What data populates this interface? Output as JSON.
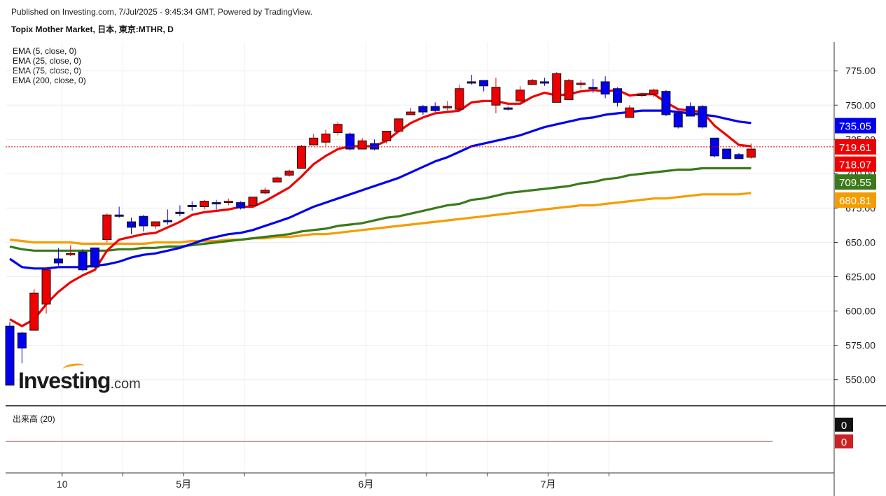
{
  "header": {
    "published": "Published on Investing.com, 7/Jul/2025 - 9:45:34 GMT, Powered by TradingView.",
    "title": "Topix Mother Market, 日本, 東京:MTHR, D"
  },
  "logo": {
    "main": "Investing",
    "suffix": ".com"
  },
  "legend": [
    {
      "label": "EMA (5, close, 0)"
    },
    {
      "label": "EMA (25, close, 0)"
    },
    {
      "label": "EMA (75, close, 0)"
    },
    {
      "label": "EMA (200, close, 0)"
    }
  ],
  "volume_panel": {
    "label": "出来高 (20)",
    "badge_values": [
      "0",
      "0"
    ]
  },
  "colors": {
    "up": "#0000ee",
    "down": "#ee0000",
    "ema5": "#ee0000",
    "ema25": "#0000ee",
    "ema75": "#3a7a1a",
    "ema200": "#f59d00",
    "grid": "#eeeeee"
  },
  "chart_data": {
    "type": "candlestick",
    "y_ticks": [
      "550.00",
      "575.00",
      "600.00",
      "625.00",
      "650.00",
      "675.00",
      "700.00",
      "725.00",
      "750.00",
      "775.00"
    ],
    "x_ticks": [
      {
        "label": "10",
        "index": 2,
        "minor": false
      },
      {
        "label": "",
        "index": 7,
        "minor": true
      },
      {
        "label": "5月",
        "index": 12,
        "minor": false
      },
      {
        "label": "",
        "index": 17,
        "minor": true
      },
      {
        "label": "6月",
        "index": 27,
        "minor": false
      },
      {
        "label": "",
        "index": 32,
        "minor": true
      },
      {
        "label": "",
        "index": 37,
        "minor": true
      },
      {
        "label": "7月",
        "index": 42,
        "minor": false
      },
      {
        "label": "",
        "index": 47,
        "minor": true
      }
    ],
    "ylim": [
      531,
      796
    ],
    "candles": [
      {
        "o": 546,
        "h": 592,
        "l": 546,
        "c": 589
      },
      {
        "o": 573,
        "h": 585,
        "l": 562,
        "c": 584
      },
      {
        "o": 613,
        "h": 616,
        "l": 586,
        "c": 586
      },
      {
        "o": 630,
        "h": 632,
        "l": 598,
        "c": 605
      },
      {
        "o": 635,
        "h": 646,
        "l": 633,
        "c": 638
      },
      {
        "o": 642,
        "h": 648,
        "l": 640,
        "c": 641
      },
      {
        "o": 630,
        "h": 645,
        "l": 629,
        "c": 643
      },
      {
        "o": 632,
        "h": 646,
        "l": 631,
        "c": 646
      },
      {
        "o": 670,
        "h": 671,
        "l": 650,
        "c": 652
      },
      {
        "o": 669,
        "h": 676,
        "l": 668,
        "c": 670
      },
      {
        "o": 661,
        "h": 668,
        "l": 656,
        "c": 665
      },
      {
        "o": 662,
        "h": 670,
        "l": 658,
        "c": 669
      },
      {
        "o": 665,
        "h": 665,
        "l": 660,
        "c": 662
      },
      {
        "o": 665,
        "h": 674,
        "l": 663,
        "c": 666
      },
      {
        "o": 671,
        "h": 677,
        "l": 669,
        "c": 672
      },
      {
        "o": 676,
        "h": 680,
        "l": 673,
        "c": 677
      },
      {
        "o": 680,
        "h": 681,
        "l": 674,
        "c": 676
      },
      {
        "o": 678,
        "h": 681,
        "l": 674,
        "c": 679
      },
      {
        "o": 680,
        "h": 682,
        "l": 677,
        "c": 679
      },
      {
        "o": 675,
        "h": 680,
        "l": 674,
        "c": 679
      },
      {
        "o": 683,
        "h": 683,
        "l": 677,
        "c": 677
      },
      {
        "o": 688,
        "h": 690,
        "l": 685,
        "c": 686
      },
      {
        "o": 697,
        "h": 698,
        "l": 694,
        "c": 694
      },
      {
        "o": 702,
        "h": 703,
        "l": 698,
        "c": 699
      },
      {
        "o": 720,
        "h": 721,
        "l": 704,
        "c": 704
      },
      {
        "o": 726,
        "h": 729,
        "l": 721,
        "c": 721
      },
      {
        "o": 729,
        "h": 732,
        "l": 720,
        "c": 723
      },
      {
        "o": 736,
        "h": 738,
        "l": 728,
        "c": 730
      },
      {
        "o": 718,
        "h": 730,
        "l": 717,
        "c": 729
      },
      {
        "o": 724,
        "h": 726,
        "l": 718,
        "c": 718
      },
      {
        "o": 718,
        "h": 725,
        "l": 717,
        "c": 722
      },
      {
        "o": 731,
        "h": 731,
        "l": 722,
        "c": 724
      },
      {
        "o": 740,
        "h": 740,
        "l": 731,
        "c": 731
      },
      {
        "o": 745,
        "h": 748,
        "l": 743,
        "c": 743
      },
      {
        "o": 745,
        "h": 750,
        "l": 743,
        "c": 749
      },
      {
        "o": 746,
        "h": 752,
        "l": 745,
        "c": 749
      },
      {
        "o": 749,
        "h": 753,
        "l": 746,
        "c": 748
      },
      {
        "o": 762,
        "h": 765,
        "l": 747,
        "c": 747
      },
      {
        "o": 767,
        "h": 772,
        "l": 765,
        "c": 767
      },
      {
        "o": 764,
        "h": 768,
        "l": 760,
        "c": 768
      },
      {
        "o": 763,
        "h": 770,
        "l": 744,
        "c": 750
      },
      {
        "o": 748,
        "h": 749,
        "l": 746,
        "c": 748
      },
      {
        "o": 761,
        "h": 764,
        "l": 752,
        "c": 753
      },
      {
        "o": 768,
        "h": 769,
        "l": 765,
        "c": 765
      },
      {
        "o": 766,
        "h": 770,
        "l": 764,
        "c": 767
      },
      {
        "o": 773,
        "h": 774,
        "l": 752,
        "c": 752
      },
      {
        "o": 768,
        "h": 769,
        "l": 754,
        "c": 754
      },
      {
        "o": 766,
        "h": 768,
        "l": 762,
        "c": 765
      },
      {
        "o": 762,
        "h": 769,
        "l": 759,
        "c": 763
      },
      {
        "o": 758,
        "h": 771,
        "l": 755,
        "c": 767
      },
      {
        "o": 752,
        "h": 763,
        "l": 749,
        "c": 762
      },
      {
        "o": 748,
        "h": 750,
        "l": 742,
        "c": 741
      },
      {
        "o": 758,
        "h": 759,
        "l": 756,
        "c": 757
      },
      {
        "o": 761,
        "h": 762,
        "l": 756,
        "c": 758
      },
      {
        "o": 743,
        "h": 761,
        "l": 742,
        "c": 760
      },
      {
        "o": 734,
        "h": 745,
        "l": 733,
        "c": 744
      },
      {
        "o": 742,
        "h": 752,
        "l": 742,
        "c": 749
      },
      {
        "o": 734,
        "h": 750,
        "l": 733,
        "c": 749
      },
      {
        "o": 713,
        "h": 726,
        "l": 712,
        "c": 726
      },
      {
        "o": 711,
        "h": 717,
        "l": 711,
        "c": 718
      },
      {
        "o": 711,
        "h": 715,
        "l": 711,
        "c": 714
      },
      {
        "o": 718,
        "h": 722,
        "l": 711,
        "c": 712
      }
    ],
    "candle_slots": [
      0,
      1,
      2,
      3,
      4,
      5,
      6,
      7,
      8,
      9,
      10,
      11,
      12,
      13,
      14,
      15,
      16,
      17,
      18,
      19,
      20,
      21,
      22,
      23,
      24,
      25,
      26,
      27,
      28,
      29,
      30,
      31,
      32,
      33,
      34,
      35,
      36,
      37,
      38,
      39,
      40,
      41,
      42,
      43,
      44,
      45,
      46,
      47,
      48,
      49,
      50,
      51,
      52,
      53,
      54,
      55,
      56,
      57,
      58,
      59,
      60,
      61
    ],
    "series": [
      {
        "name": "EMA (5, close, 0)",
        "color": "#ee0000",
        "last": "719.61",
        "values": [
          594,
          589,
          594,
          605,
          614,
          621,
          626,
          630,
          644,
          652,
          654,
          656,
          657,
          661,
          665,
          670,
          672,
          673,
          674,
          676,
          676,
          680,
          685,
          690,
          698,
          707,
          713,
          718,
          720,
          720,
          720,
          724,
          731,
          737,
          741,
          744,
          745,
          746,
          752,
          753,
          753,
          751,
          751,
          756,
          759,
          757,
          758,
          760,
          761,
          760,
          761,
          757,
          758,
          758,
          752,
          747,
          746,
          745,
          735,
          728,
          721,
          720
        ]
      },
      {
        "name": "EMA (25, close, 0)",
        "color": "#0000ee",
        "last": "735.05",
        "values": [
          638,
          632,
          631,
          631,
          632,
          632,
          632,
          633,
          634,
          636,
          639,
          641,
          642,
          644,
          646,
          649,
          652,
          654,
          656,
          657,
          659,
          662,
          665,
          668,
          672,
          676,
          679,
          682,
          685,
          688,
          691,
          694,
          697,
          701,
          705,
          709,
          712,
          716,
          720,
          722,
          724,
          726,
          728,
          731,
          734,
          736,
          738,
          740,
          741,
          743,
          744,
          745,
          746,
          746,
          746,
          745,
          744,
          743,
          742,
          740,
          738,
          737
        ]
      },
      {
        "name": "EMA (75, close, 0)",
        "color": "#3a7a1a",
        "last": "709.55",
        "values": [
          647,
          645,
          644,
          644,
          644,
          644,
          644,
          644,
          644,
          645,
          645,
          646,
          646,
          647,
          647,
          648,
          649,
          650,
          651,
          652,
          653,
          654,
          655,
          656,
          658,
          659,
          660,
          662,
          663,
          664,
          666,
          668,
          669,
          671,
          673,
          675,
          677,
          678,
          681,
          682,
          684,
          686,
          687,
          688,
          689,
          690,
          691,
          693,
          694,
          696,
          697,
          699,
          700,
          701,
          702,
          703,
          703,
          704,
          704,
          704,
          704,
          704
        ]
      },
      {
        "name": "EMA (200, close, 0)",
        "color": "#f59d00",
        "last": "680.81",
        "values": [
          652,
          651,
          650,
          650,
          650,
          650,
          649,
          649,
          649,
          649,
          649,
          649,
          650,
          650,
          650,
          651,
          651,
          651,
          652,
          652,
          653,
          653,
          654,
          654,
          655,
          656,
          656,
          657,
          658,
          659,
          660,
          661,
          662,
          663,
          664,
          665,
          666,
          667,
          668,
          669,
          670,
          671,
          672,
          673,
          674,
          675,
          676,
          677,
          677,
          678,
          679,
          680,
          681,
          682,
          682,
          683,
          684,
          685,
          685,
          685,
          685,
          686
        ]
      }
    ],
    "price_line": {
      "value": "718.07",
      "at": 719.6
    },
    "badges": [
      {
        "text": "735.05",
        "bg": "#0000ee",
        "at": 735.05
      },
      {
        "text": "719.61",
        "bg": "#ee0000",
        "at": 719.61
      },
      {
        "text": "718.07",
        "bg": "#ee0000",
        "at": 707.0
      },
      {
        "text": "709.55",
        "bg": "#3a7a1a",
        "at": 694.0
      },
      {
        "text": "680.81",
        "bg": "#f59d00",
        "at": 680.81
      }
    ]
  }
}
